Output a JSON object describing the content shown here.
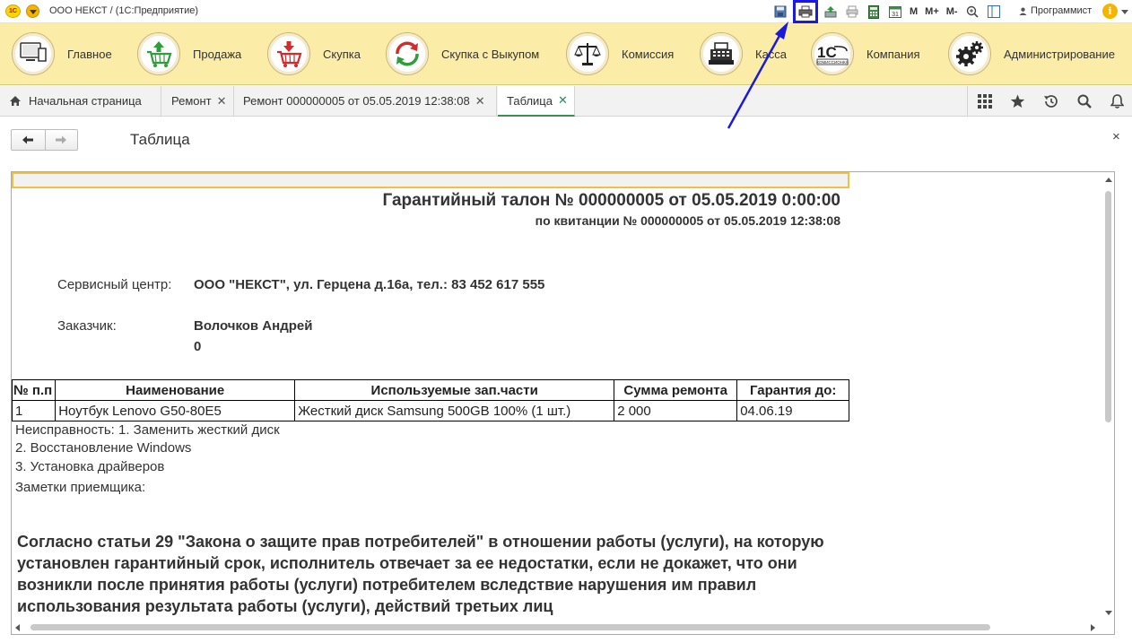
{
  "titlebar": {
    "app_title": "ООО НЕКСТ /  (1С:Предприятие)",
    "logo_text": "1С",
    "quick_buttons": [
      "save-icon",
      "print-icon",
      "export-icon",
      "print-preview-icon",
      "calculator-icon",
      "calendar-icon"
    ],
    "memory_labels": [
      "M",
      "M+",
      "M-"
    ],
    "user": "Программист",
    "info_glyph": "i"
  },
  "sections": [
    {
      "label": "Главное",
      "icon": "monitor-icon"
    },
    {
      "label": "Продажа",
      "icon": "cart-sell-icon"
    },
    {
      "label": "Скупка",
      "icon": "cart-buy-icon"
    },
    {
      "label": "Скупка с Выкупом",
      "icon": "cycle-arrows-icon"
    },
    {
      "label": "Комиссия",
      "icon": "scales-icon"
    },
    {
      "label": "Касса",
      "icon": "cash-register-icon"
    },
    {
      "label": "Компания",
      "icon": "1c-company-icon"
    },
    {
      "label": "Администрирование",
      "icon": "gears-icon"
    }
  ],
  "tabs": [
    {
      "label": "Начальная страница",
      "closable": false
    },
    {
      "label": "Ремонт",
      "closable": true
    },
    {
      "label": "Ремонт 000000005 от 05.05.2019 12:38:08",
      "closable": true
    },
    {
      "label": "Таблица",
      "closable": true,
      "active": true
    }
  ],
  "form": {
    "title": "Таблица"
  },
  "document": {
    "title": "Гарантийный талон № 000000005 от 05.05.2019 0:00:00",
    "subtitle": "по квитанции № 000000005 от 05.05.2019 12:38:08",
    "service_center_label": "Сервисный центр:",
    "service_center_value": "ООО \"НЕКСТ\", ул. Герцена д.16а, тел.: 83 452 617 555",
    "customer_label": "Заказчик:",
    "customer_name": "Волочков Андрей",
    "customer_extra": "0",
    "table": {
      "headers": [
        "№ п.п",
        "Наименование",
        "Используемые зап.части",
        "Сумма  ремонта",
        "Гарантия до:"
      ],
      "rows": [
        [
          "1",
          "Ноутбук Lenovo G50-80E5",
          "Жесткий диск Samsung 500GB 100% (1 шт.)",
          "2 000",
          "04.06.19"
        ]
      ]
    },
    "faults": [
      "Неисправность: 1. Заменить жесткий диск",
      "2. Восстановление Windows",
      "3. Установка драйверов"
    ],
    "receiver_notes_label": "Заметки приемщика:",
    "law_paragraph": "Согласно статьи 29 \"Закона о защите прав потребителей\" в отношении работы (услуги), на которую установлен гарантийный срок, исполнитель отвечает за ее недостатки, если не докажет, что они возникли после принятия работы (услуги) потребителем вследствие нарушения им правил использования результата работы (услуги), действий третьих лиц"
  },
  "colors": {
    "sections_bg": "#fbeca8",
    "active_tab_accent": "#3b8c50",
    "highlight_box": "#1a1adb",
    "selected_cell": "#f0c040"
  }
}
